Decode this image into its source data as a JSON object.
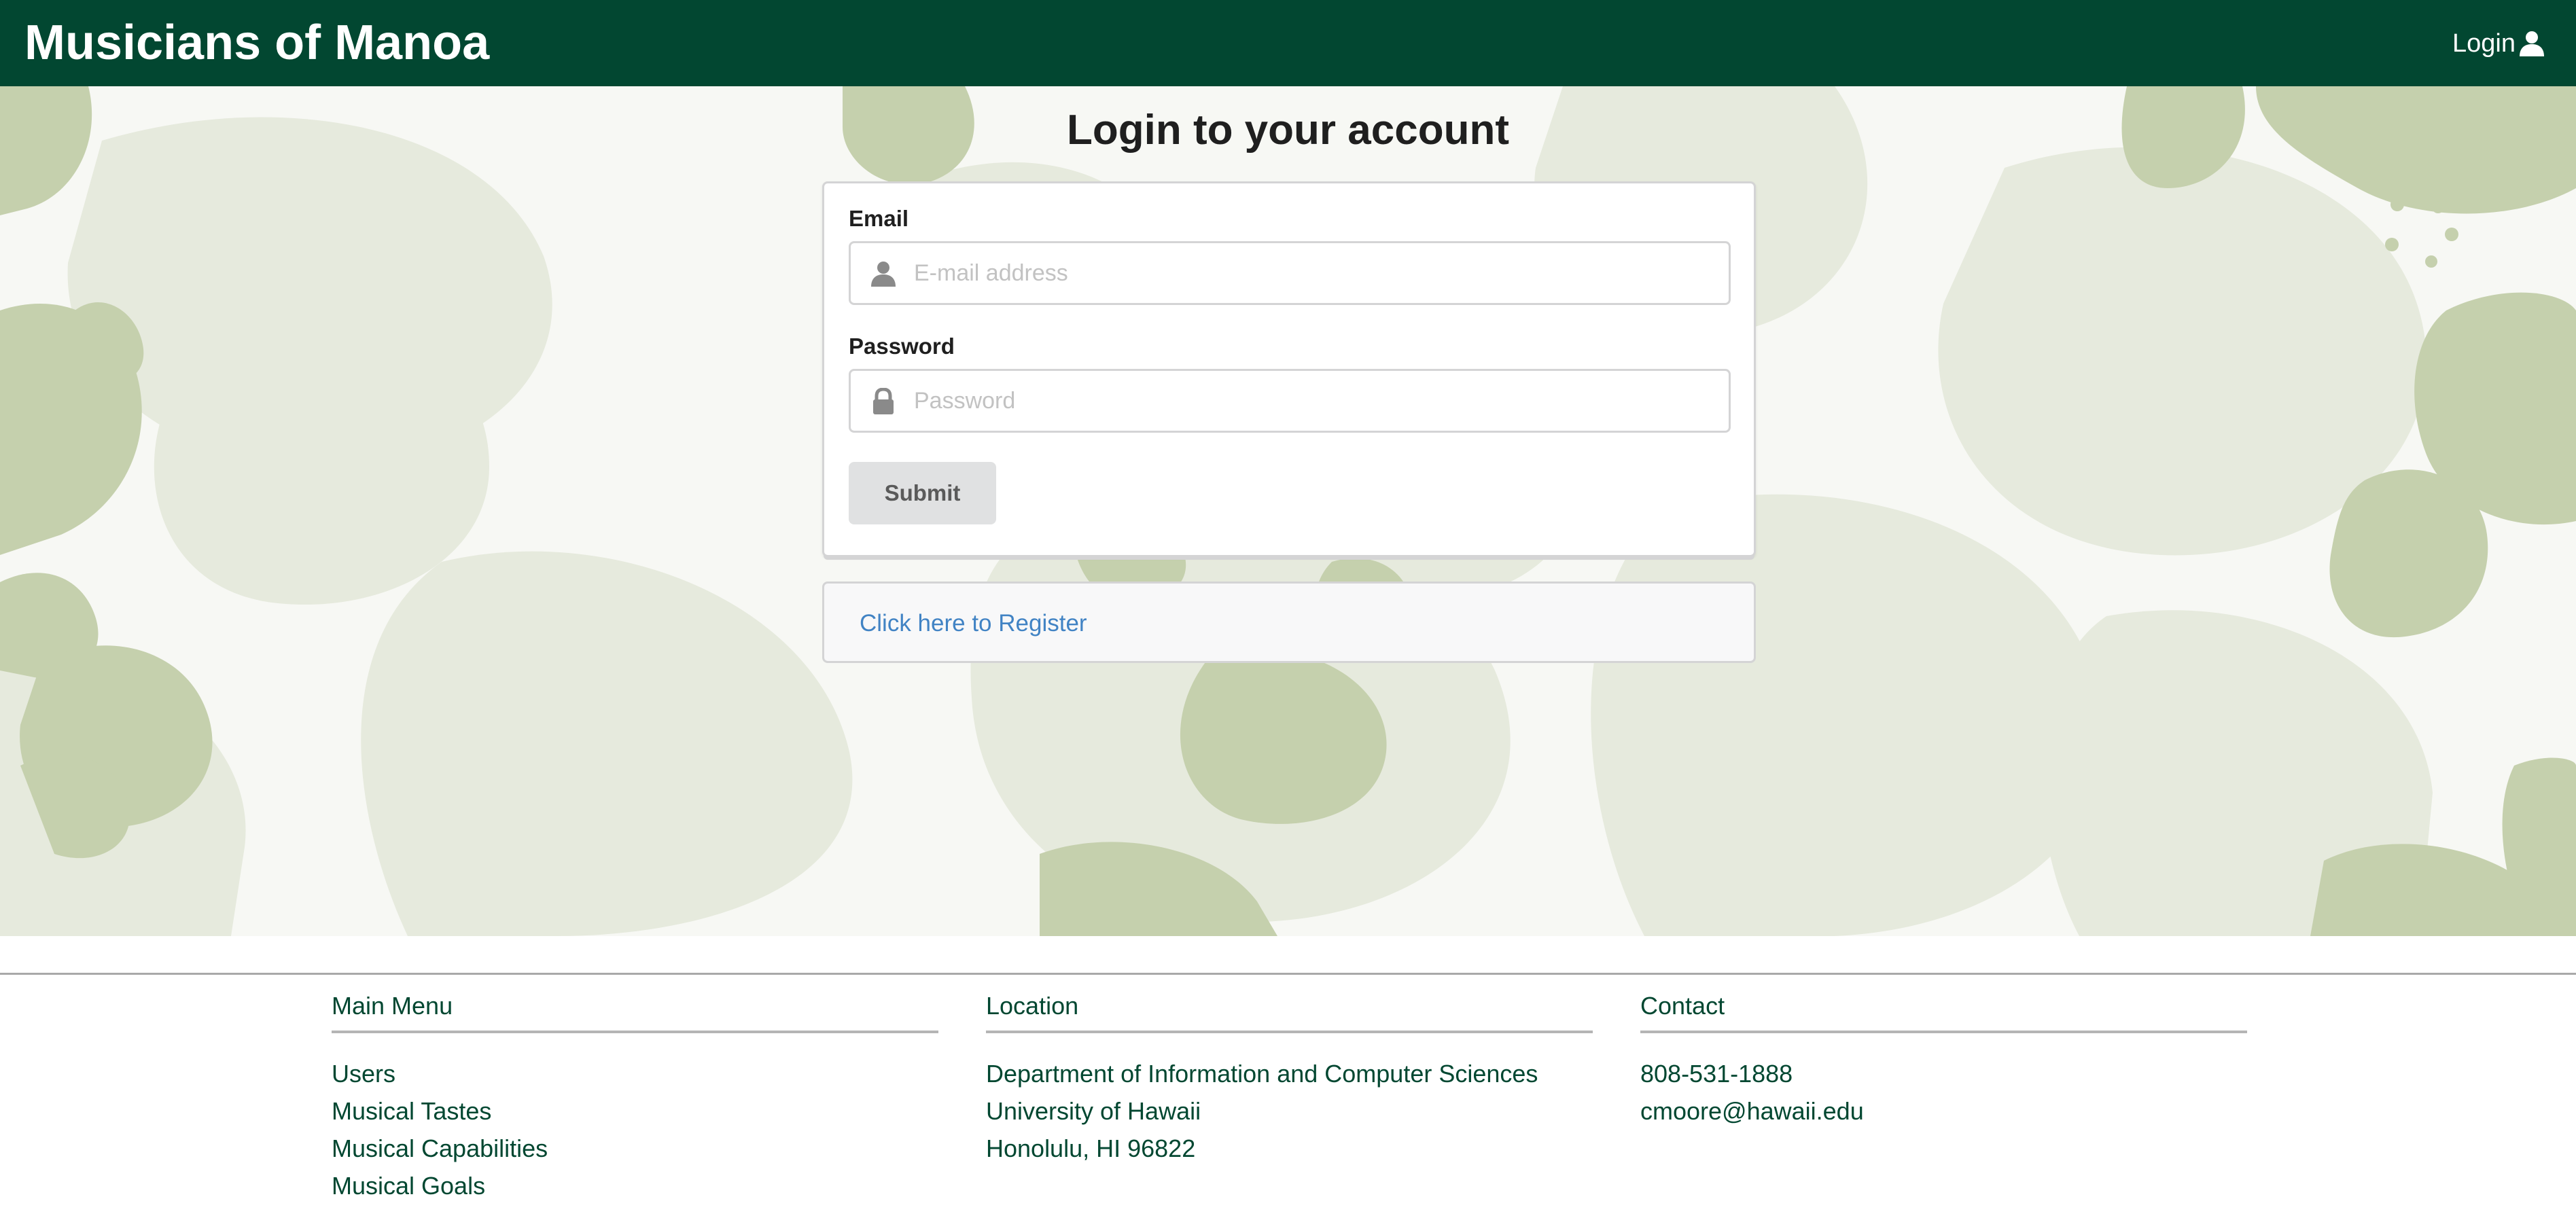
{
  "navbar": {
    "brand": "Musicians of Manoa",
    "login_label": "Login",
    "login_icon": "user-icon",
    "background_color": "#024731"
  },
  "main": {
    "title": "Login to your account",
    "form": {
      "email_label": "Email",
      "email_placeholder": "E-mail address",
      "email_value": "",
      "email_icon": "user-icon",
      "password_label": "Password",
      "password_placeholder": "Password",
      "password_value": "",
      "password_icon": "lock-icon",
      "submit_label": "Submit"
    },
    "register_link": "Click here to Register",
    "link_color": "#4183c4"
  },
  "footer": {
    "columns": [
      {
        "heading": "Main Menu",
        "lines": [
          "Users",
          "Musical Tastes",
          "Musical Capabilities",
          "Musical Goals"
        ]
      },
      {
        "heading": "Location",
        "lines": [
          "Department of Information and Computer Sciences",
          "University of Hawaii",
          "Honolulu, HI 96822"
        ]
      },
      {
        "heading": "Contact",
        "lines": [
          "808-531-1888",
          "cmoore@hawaii.edu"
        ]
      }
    ],
    "text_color": "#024731"
  }
}
